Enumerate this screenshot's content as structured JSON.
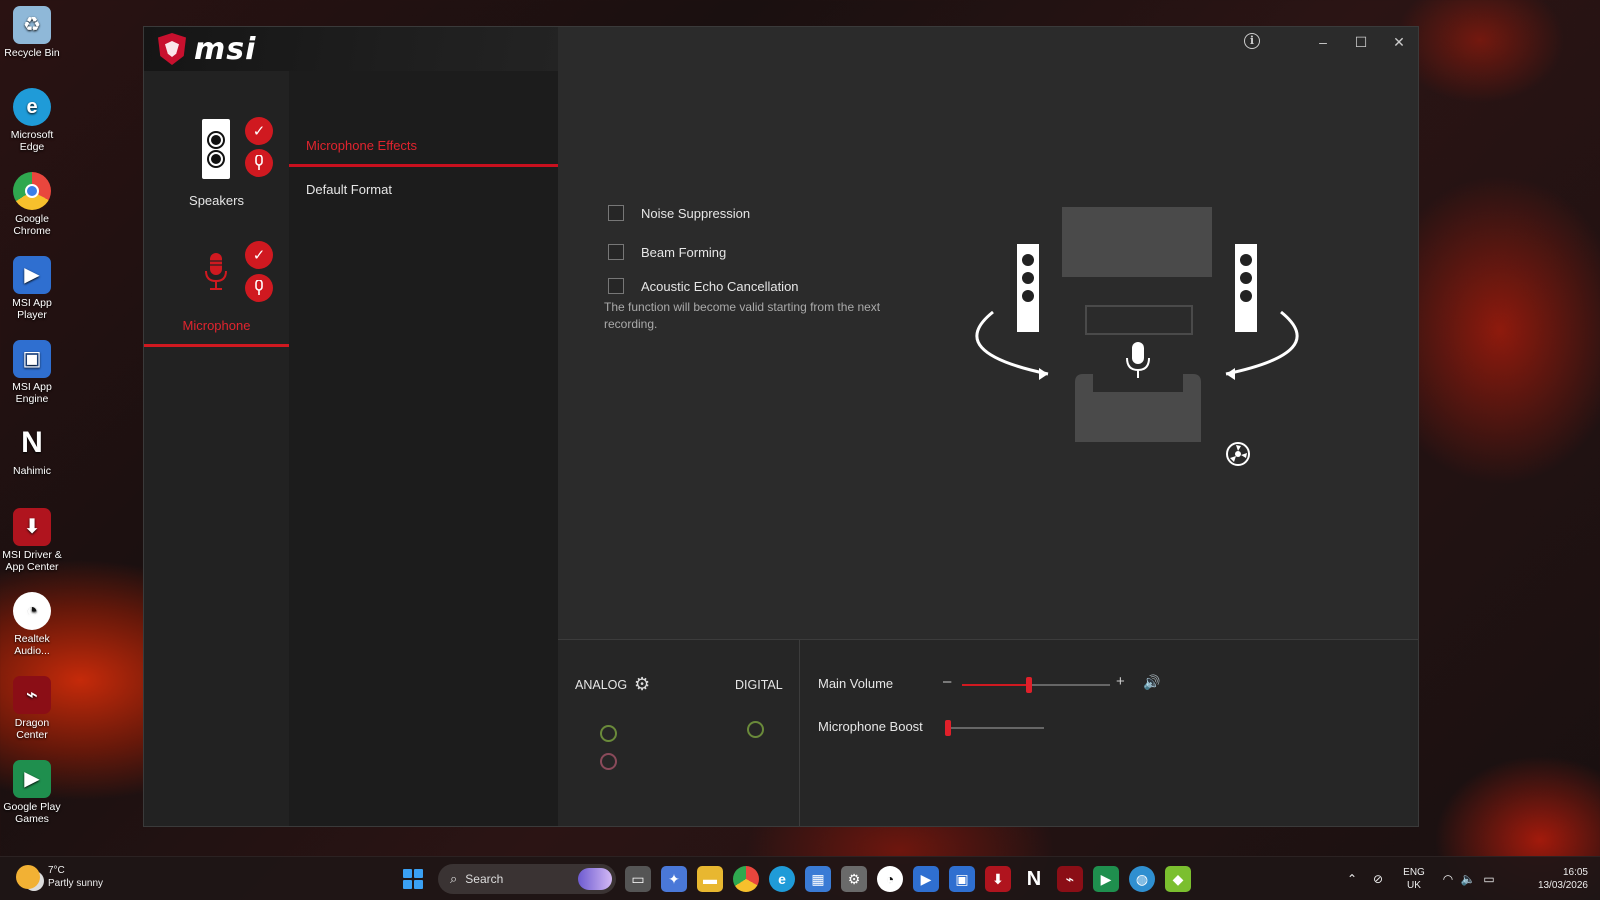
{
  "desktop": {
    "icons": [
      {
        "label": "Recycle Bin",
        "icon": "recycle-bin-icon",
        "color": "#8fb8d8"
      },
      {
        "label": "Microsoft Edge",
        "icon": "edge-icon",
        "color": "#1f9bd8"
      },
      {
        "label": "Google Chrome",
        "icon": "chrome-icon",
        "color": "#e9463d"
      },
      {
        "label": "MSI App Player",
        "icon": "msi-app-player-icon",
        "color": "#2f6fd0"
      },
      {
        "label": "MSI App Engine",
        "icon": "msi-app-engine-icon",
        "color": "#2f6fd0"
      },
      {
        "label": "Nahimic",
        "icon": "nahimic-icon",
        "color": "#222222"
      },
      {
        "label": "MSI Driver & App Center",
        "icon": "msi-driver-icon",
        "color": "#b0141e"
      },
      {
        "label": "Realtek Audio...",
        "icon": "realtek-icon",
        "color": "#1a1a1a"
      },
      {
        "label": "Dragon Center",
        "icon": "dragon-center-icon",
        "color": "#8b0e16"
      },
      {
        "label": "Google Play Games",
        "icon": "google-play-games-icon",
        "color": "#1f8f4e"
      }
    ]
  },
  "app": {
    "brand": "msi",
    "devices": [
      {
        "label": "Speakers",
        "active": false
      },
      {
        "label": "Microphone",
        "active": true
      }
    ],
    "submenu": [
      {
        "label": "Microphone Effects",
        "active": true
      },
      {
        "label": "Default Format",
        "active": false
      }
    ],
    "window_controls": {
      "minimize": "–",
      "maximize": "☐",
      "close": "✕",
      "info": "i"
    },
    "options": [
      {
        "label": "Noise Suppression",
        "checked": false
      },
      {
        "label": "Beam Forming",
        "checked": false
      },
      {
        "label": "Acoustic Echo Cancellation",
        "checked": false
      }
    ],
    "note": "The function will become valid starting from the next recording.",
    "io": {
      "analog_label": "ANALOG",
      "digital_label": "DIGITAL",
      "jack_colors": {
        "green": "#6a8a3a",
        "pink": "#8a4a5a"
      }
    },
    "volume": {
      "main_label": "Main Volume",
      "main_value": 45,
      "minus": "–",
      "plus": "+",
      "boost_label": "Microphone Boost",
      "boost_value": 0
    },
    "accent": "#d01920"
  },
  "taskbar": {
    "weather_temp": "7°C",
    "weather_desc": "Partly sunny",
    "search_placeholder": "Search",
    "lang_top": "ENG",
    "lang_bottom": "UK",
    "time": "16:05",
    "date": "13/03/2026",
    "apps": [
      {
        "icon": "task-view-icon",
        "color": "#555555"
      },
      {
        "icon": "copilot-icon",
        "color": "#4a78d8"
      },
      {
        "icon": "file-explorer-icon",
        "color": "#e8b730"
      },
      {
        "icon": "chrome-icon",
        "color": "#e9463d"
      },
      {
        "icon": "edge-icon",
        "color": "#1f9bd8"
      },
      {
        "icon": "store-icon",
        "color": "#3a7bd5"
      },
      {
        "icon": "msi-center-icon",
        "color": "#6a6a6a"
      },
      {
        "icon": "realtek-icon",
        "color": "#1a1a1a"
      },
      {
        "icon": "msi-app-player-icon",
        "color": "#2f6fd0"
      },
      {
        "icon": "msi-app-engine-icon",
        "color": "#2f6fd0"
      },
      {
        "icon": "msi-driver-icon",
        "color": "#b0141e"
      },
      {
        "icon": "nahimic-icon",
        "color": "#222222"
      },
      {
        "icon": "dragon-center-icon",
        "color": "#8b0e16"
      },
      {
        "icon": "google-play-games-icon",
        "color": "#1f8f4e"
      },
      {
        "icon": "globe-icon",
        "color": "#2f8fd0"
      },
      {
        "icon": "android-icon",
        "color": "#7bbf2f"
      }
    ]
  }
}
